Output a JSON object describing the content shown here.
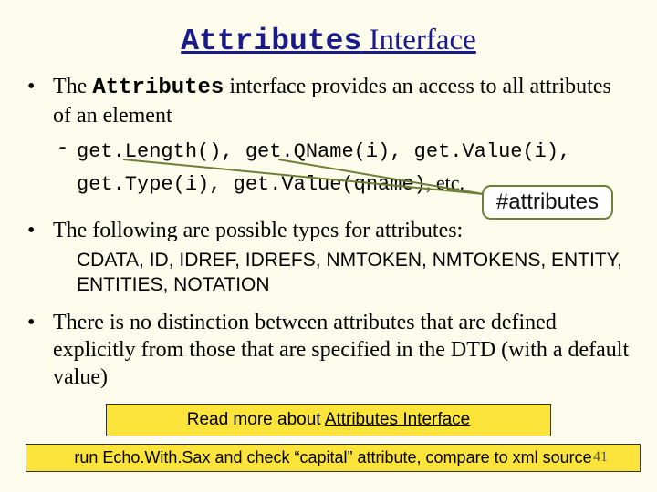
{
  "title": {
    "code": "Attributes",
    "plain": " Interface"
  },
  "bullet1": {
    "pre": "The ",
    "kw": "Attributes",
    "post": " interface provides an access to all attributes of an element"
  },
  "methods": {
    "line1": "get.Length(), get.QName(i), get.Value(i),",
    "line2_code": "get.Type(i), get.Value(qname)",
    "line2_tail": ", etc."
  },
  "callout": "#attributes",
  "bullet2": "The following are possible types for attributes:",
  "types": "CDATA, ID, IDREF, IDREFS, NMTOKEN, NMTOKENS, ENTITY, ENTITIES, NOTATION",
  "bullet3": "There is no distinction between attributes that are defined explicitly from those that are specified in the DTD (with a default value)",
  "readmore": {
    "pre": "Read more about ",
    "link": "Attributes Interface"
  },
  "runbox": "run Echo.With.Sax and check “capital” attribute, compare to xml source",
  "pagenum": "41"
}
